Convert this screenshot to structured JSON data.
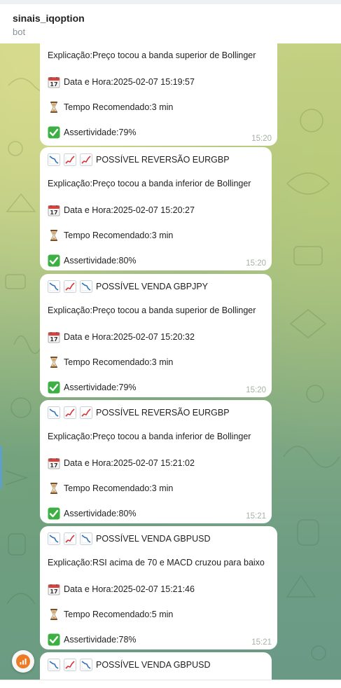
{
  "header": {
    "title": "sinais_iqoption",
    "subtitle": "bot"
  },
  "labels": {
    "explicacao": "Explicação: ",
    "data_hora": "Data e Hora: ",
    "tempo": "Tempo Recomendado: ",
    "assertividade": "Assertividade: "
  },
  "messages": [
    {
      "title": "",
      "explanation": "Preço tocou a banda superior de Bollinger",
      "datetime": "2025-02-07 15:19:57",
      "tempo": "3 min",
      "assertividade": "79%",
      "time": "15:20"
    },
    {
      "title": "POSSÍVEL REVERSÃO EURGBP",
      "title_icons": [
        "chart-down",
        "chart-up",
        "chart-up"
      ],
      "explanation": "Preço tocou a banda inferior de Bollinger",
      "datetime": "2025-02-07 15:20:27",
      "tempo": "3 min",
      "assertividade": "80%",
      "time": "15:20"
    },
    {
      "title": "POSSÍVEL VENDA GBPJPY",
      "title_icons": [
        "chart-down",
        "chart-up",
        "chart-down"
      ],
      "explanation": "Preço tocou a banda superior de Bollinger",
      "datetime": "2025-02-07 15:20:32",
      "tempo": "3 min",
      "assertividade": "79%",
      "time": "15:20"
    },
    {
      "title": "POSSÍVEL REVERSÃO EURGBP",
      "title_icons": [
        "chart-down",
        "chart-up",
        "chart-up"
      ],
      "explanation": "Preço tocou a banda inferior de Bollinger",
      "datetime": "2025-02-07 15:21:02",
      "tempo": "3 min",
      "assertividade": "80%",
      "time": "15:21"
    },
    {
      "title": "POSSÍVEL VENDA GBPUSD",
      "title_icons": [
        "chart-down",
        "chart-up",
        "chart-down"
      ],
      "explanation": "RSI acima de 70 e MACD cruzou para baixo",
      "datetime": "2025-02-07 15:21:46",
      "tempo": "5 min",
      "assertividade": "78%",
      "time": "15:21"
    },
    {
      "title": "POSSÍVEL VENDA GBPUSD",
      "title_icons": [
        "chart-down",
        "chart-up",
        "chart-down"
      ]
    }
  ],
  "icons": {
    "calendar": "calendar-icon",
    "hourglass": "hourglass-icon",
    "check": "check-mark-icon",
    "fab": "chart-bars-icon"
  },
  "colors": {
    "bubble": "#ffffff",
    "timestamp": "#a7b1a5",
    "fab_accent": "#ec7b25",
    "check_green": "#3cb043"
  }
}
